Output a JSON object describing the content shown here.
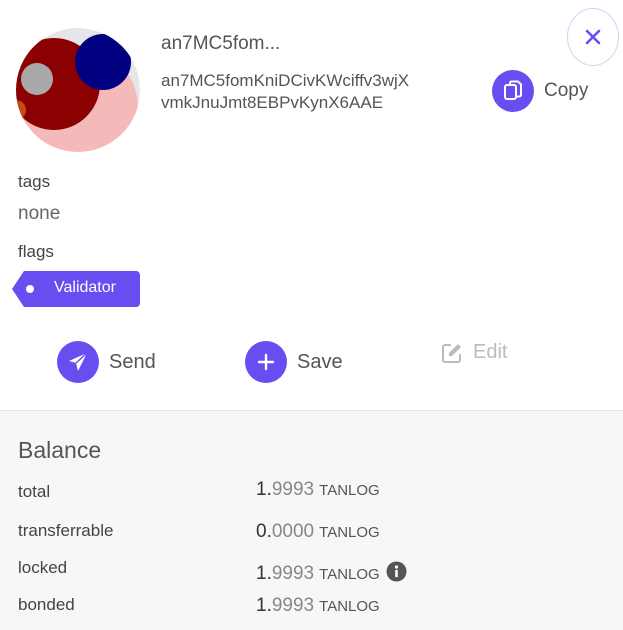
{
  "account": {
    "short_name": "an7MC5fom...",
    "address": "an7MC5fomKniDCivKWciffv3wjXvmkJnuJmt8EBPvKynX6AAE"
  },
  "copy": {
    "label": "Copy"
  },
  "tags": {
    "label": "tags",
    "value": "none"
  },
  "flags": {
    "label": "flags",
    "items": [
      "Validator"
    ]
  },
  "actions": {
    "send": "Send",
    "save": "Save",
    "edit": "Edit"
  },
  "balance": {
    "title": "Balance",
    "rows": [
      {
        "label": "total",
        "int": "1.",
        "dec": "9993",
        "unit": "TANLOG"
      },
      {
        "label": "transferrable",
        "int": "0.",
        "dec": "0000",
        "unit": "TANLOG"
      },
      {
        "label": "locked",
        "int": "1.",
        "dec": "9993",
        "unit": "TANLOG"
      },
      {
        "label": "bonded",
        "int": "1.",
        "dec": "9993",
        "unit": "TANLOG"
      }
    ]
  },
  "colors": {
    "accent": "#6a4df1",
    "panel_bg": "#f7f7f8"
  }
}
